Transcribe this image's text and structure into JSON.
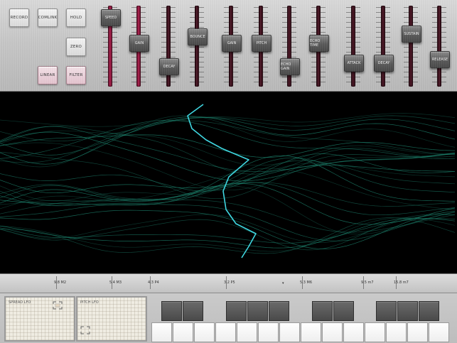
{
  "buttons": {
    "record": "RECORD",
    "comlink": "COMLINK",
    "hold": "HOLD",
    "zero": "ZERO",
    "linear": "LINEAR",
    "filter": "FILTER"
  },
  "sliders": [
    {
      "label": "SPEED",
      "level": 0.95,
      "lit": true
    },
    {
      "label": "GAIN",
      "level": 0.55,
      "lit": true
    },
    {
      "label": "DECAY",
      "level": 0.2,
      "lit": false
    },
    {
      "label": "BOUNCE",
      "level": 0.65,
      "lit": false
    },
    {
      "label": "GAIN",
      "level": 0.55,
      "lit": false
    },
    {
      "label": "PITCH",
      "level": 0.55,
      "lit": false
    },
    {
      "label": "ECHO GAIN",
      "level": 0.2,
      "lit": false
    },
    {
      "label": "ECHO TIME",
      "level": 0.55,
      "lit": false
    },
    {
      "label": "ATTACK",
      "level": 0.25,
      "lit": false
    },
    {
      "label": "DECAY",
      "level": 0.25,
      "lit": false
    },
    {
      "label": "SUSTAIN",
      "level": 0.7,
      "lit": false
    },
    {
      "label": "RELEASE",
      "level": 0.3,
      "lit": false
    }
  ],
  "ruler": {
    "labels": [
      "9.8 M2",
      "5.4 M3",
      "4.3 P4",
      "3.2 P5",
      "5.3 M6",
      "9.5 m7",
      "15.8 m7"
    ],
    "marker": "▾"
  },
  "lfo": {
    "spread": "SPREAD LFO",
    "pitch": "PITCH LFO"
  },
  "colors": {
    "trace": "#1f8f78",
    "cursor": "#3fd6e0",
    "slider_lit": "#b0204f"
  }
}
